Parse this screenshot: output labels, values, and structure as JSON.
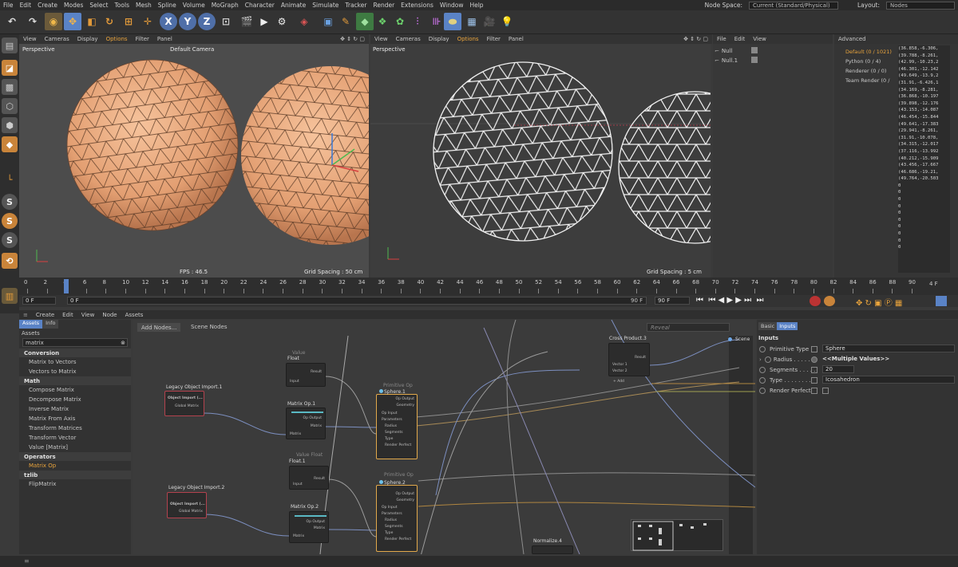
{
  "menu": [
    "File",
    "Edit",
    "Create",
    "Modes",
    "Select",
    "Tools",
    "Mesh",
    "Spline",
    "Volume",
    "MoGraph",
    "Character",
    "Animate",
    "Simulate",
    "Tracker",
    "Render",
    "Extensions",
    "Window",
    "Help"
  ],
  "node_space_label": "Node Space:",
  "node_space_value": "Current (Standard/Physical)",
  "layout_label": "Layout:",
  "layout_value": "Nodes",
  "toolbar_axes": [
    "X",
    "Y",
    "Z"
  ],
  "viewport_menu": [
    "View",
    "Cameras",
    "Display",
    "Options",
    "Filter",
    "Panel"
  ],
  "viewport1": {
    "label": "Perspective",
    "camera": "Default Camera",
    "fps": "FPS : 46.5",
    "grid": "Grid Spacing : 50 cm"
  },
  "viewport2": {
    "label": "Perspective",
    "grid": "Grid Spacing : 5 cm"
  },
  "objects_menu": [
    "File",
    "Edit",
    "View"
  ],
  "objects": [
    "Null",
    "Null.1"
  ],
  "attr_top_title": "Advanced",
  "console_items": [
    "Default (0 / 1021)",
    "Python (0 / 4)",
    "Renderer (0 / 0)",
    "Team Render (0 /"
  ],
  "console_lines": [
    "(36.858,-6.306,",
    "(39.788,-8.261,",
    "(42.99,-10.23,2",
    "(46.301,-12.142",
    "(49.649,-13.9,2",
    "(31.91,-6.426,1",
    "(34.169,-8.281,",
    "(36.868,-10.197",
    "(39.898,-12.176",
    "(43.153,-14.087",
    "(46.454,-15.844",
    "(49.641,-17.383",
    "(29.941,-8.261,",
    "(31.91,-10.078,",
    "(34.315,-12.017",
    "(37.116,-13.992",
    "(40.212,-15.909",
    "(43.456,-17.667",
    "(46.686,-19.21,",
    "(49.764,-20.503",
    "0",
    "0",
    "0",
    "0",
    "0",
    "0",
    "0",
    "0",
    "0",
    "0"
  ],
  "ruler": [
    "0",
    "2",
    "4",
    "6",
    "8",
    "10",
    "12",
    "14",
    "16",
    "18",
    "20",
    "22",
    "24",
    "26",
    "28",
    "30",
    "32",
    "34",
    "36",
    "38",
    "40",
    "42",
    "44",
    "46",
    "48",
    "50",
    "52",
    "54",
    "56",
    "58",
    "60",
    "62",
    "64",
    "66",
    "68",
    "70",
    "72",
    "74",
    "76",
    "78",
    "80",
    "82",
    "84",
    "86",
    "88",
    "90"
  ],
  "current_frame": "4 F",
  "start_frame": "0 F",
  "frame_field": "0 F",
  "end_frame_a": "90 F",
  "end_frame_b": "90 F",
  "node_menu": [
    "Create",
    "Edit",
    "View",
    "Node",
    "Assets"
  ],
  "asset_tabs": [
    "Assets",
    "Info"
  ],
  "assets_title": "Assets",
  "asset_search": "matrix",
  "asset_categories": [
    {
      "name": "Conversion",
      "items": [
        "Matrix to Vectors",
        "Vectors to Matrix"
      ]
    },
    {
      "name": "Math",
      "items": [
        "Compose Matrix",
        "Decompose Matrix",
        "Inverse Matrix",
        "Matrix From Axis",
        "Transform Matrices",
        "Transform Vector",
        "Value [Matrix]"
      ]
    },
    {
      "name": "Operators",
      "items": [
        "Matrix Op"
      ]
    },
    {
      "name": "tzlib",
      "items": [
        "FlipMatrix"
      ]
    }
  ],
  "canvas_tabs": [
    "Add Nodes...",
    "Scene Nodes"
  ],
  "canvas_search": "Reveal",
  "nodes": {
    "float": {
      "group": "Value",
      "title": "Float",
      "out": "Result",
      "in": "Input"
    },
    "float1": {
      "group": "Value Float",
      "title": "Float.1",
      "out": "Result",
      "in": "Input"
    },
    "legacy1": {
      "title": "Legacy Object Import.1",
      "body": "Object Import (...",
      "out": "Global Matrix"
    },
    "legacy2": {
      "title": "Legacy Object Import.2",
      "body": "Object Import (...",
      "out": "Global Matrix"
    },
    "matrixop1": {
      "title": "Matrix Op.1",
      "out": "Op Output",
      "p1": "Matrix",
      "in": "Matrix"
    },
    "matrixop2": {
      "title": "Matrix Op.2",
      "out": "Op Output",
      "p1": "Matrix",
      "in": "Matrix"
    },
    "sphere1": {
      "group": "Primitive Op",
      "title": "Sphere.1",
      "ports": [
        "Op Output",
        "Geometry",
        "Op Input",
        "Parameters",
        "Radius",
        "Segments",
        "Type",
        "Render Perfect"
      ]
    },
    "sphere2": {
      "group": "Primitive Op",
      "title": "Sphere.2",
      "ports": [
        "Op Output",
        "Geometry",
        "Op Input",
        "Parameters",
        "Radius",
        "Segments",
        "Type",
        "Render Perfect"
      ]
    },
    "cross": {
      "title": "Cross Product.3",
      "out": "Result",
      "in1": "Vector 1",
      "in2": "Vector 2",
      "add": "+ Add"
    },
    "normalize": {
      "title": "Normalize.4"
    },
    "scene": {
      "title": "Scene"
    }
  },
  "attr_tabs": [
    "Basic",
    "Inputs"
  ],
  "attr_section": "Inputs",
  "attr_rows": [
    {
      "label": "Primitive Type",
      "value": "Sphere"
    },
    {
      "label": "Radius . . . . . . .",
      "value": "<<Multiple Values>>"
    },
    {
      "label": "Segments . . . . .",
      "value": "20"
    },
    {
      "label": "Type . . . . . . . .",
      "value": "Icosahedron"
    },
    {
      "label": "Render Perfect",
      "value": ""
    }
  ],
  "colors": {
    "accent": "#e8a33c",
    "sphere": "#e8a57a",
    "selected": "#5a83c6"
  }
}
